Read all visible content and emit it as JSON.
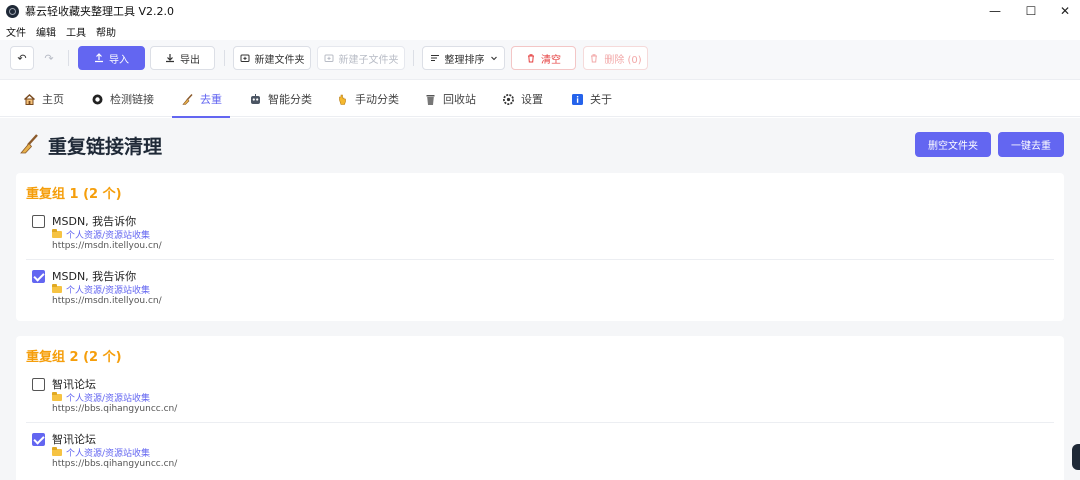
{
  "app": {
    "title": "慕云轻收藏夹整理工具 V2.2.0",
    "window_controls": {
      "minimize": "—",
      "maximize": "☐",
      "close": "✕"
    }
  },
  "menu": [
    "文件",
    "编辑",
    "工具",
    "帮助"
  ],
  "toolbar": {
    "undo_icon": "↶",
    "redo_icon": "↷",
    "import_label": "导入",
    "export_label": "导出",
    "new_folder_label": "新建文件夹",
    "new_subfolder_label": "新建子文件夹",
    "sort_label": "整理排序",
    "clear_label": "清空",
    "delete_label": "删除 (0)",
    "accent_color": "#6366f1",
    "danger_color": "#e53e3e"
  },
  "tabs": [
    {
      "label": "主页",
      "icon": "home-icon"
    },
    {
      "label": "检测链接",
      "icon": "link-check-icon"
    },
    {
      "label": "去重",
      "icon": "broom-icon",
      "active": true
    },
    {
      "label": "智能分类",
      "icon": "robot-icon"
    },
    {
      "label": "手动分类",
      "icon": "hand-icon"
    },
    {
      "label": "回收站",
      "icon": "trash-icon"
    },
    {
      "label": "设置",
      "icon": "gear-icon"
    },
    {
      "label": "关于",
      "icon": "info-icon"
    }
  ],
  "page": {
    "title": "重复链接清理",
    "delete_empty_folders_label": "删空文件夹",
    "one_click_dedupe_label": "一键去重"
  },
  "groups": [
    {
      "title": "重复组 1 (2 个)",
      "items": [
        {
          "name": "MSDN, 我告诉你",
          "folder": "个人资源/资源站收集",
          "url": "https://msdn.itellyou.cn/",
          "checked": false
        },
        {
          "name": "MSDN, 我告诉你",
          "folder": "个人资源/资源站收集",
          "url": "https://msdn.itellyou.cn/",
          "checked": true
        }
      ]
    },
    {
      "title": "重复组 2 (2 个)",
      "items": [
        {
          "name": "智讯论坛",
          "folder": "个人资源/资源站收集",
          "url": "https://bbs.qihangyuncc.cn/",
          "checked": false
        },
        {
          "name": "智讯论坛",
          "folder": "个人资源/资源站收集",
          "url": "https://bbs.qihangyuncc.cn/",
          "checked": true
        }
      ]
    }
  ]
}
